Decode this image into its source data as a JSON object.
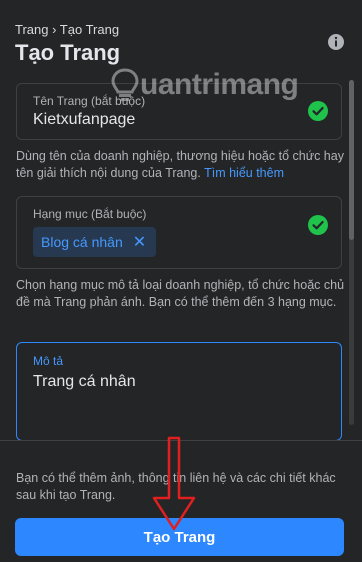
{
  "header": {
    "breadcrumb": "Trang › Tạo Trang",
    "title": "Tạo Trang"
  },
  "page_name": {
    "label": "Tên Trang (bắt buộc)",
    "value": "Kietxufanpage",
    "help_text": "Dùng tên của doanh nghiệp, thương hiệu hoặc tổ chức hay tên giải thích nội dung của Trang.",
    "help_link": "Tìm hiểu thêm"
  },
  "category": {
    "label": "Hạng mục (Bắt buộc)",
    "chip": "Blog cá nhân",
    "chip_remove": "✕",
    "help_text": "Chọn hạng mục mô tả loại doanh nghiệp, tổ chức hoặc chủ đề mà Trang phản ánh. Bạn có thể thêm đến 3 hạng mục."
  },
  "description": {
    "label": "Mô tả",
    "value": "Trang cá nhân"
  },
  "footer": {
    "note": "Bạn có thể thêm ảnh, thông tin liên hệ và các chi tiết khác sau khi tạo Trang.",
    "submit_label": "Tạo Trang"
  },
  "watermark": {
    "text": "uantrimang"
  },
  "colors": {
    "background": "#242526",
    "accent": "#2d88ff",
    "success": "#1fc24b",
    "annotation": "#e02020"
  }
}
